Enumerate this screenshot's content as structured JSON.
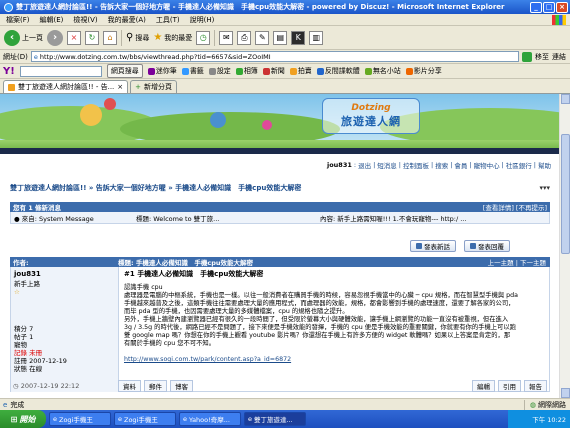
{
  "window": {
    "title": "雙丁旅遊達人網討論區!! - 告訴大家一個好地方喔 - 手機達人必備知識　手機cpu效能大解密 - powered by Discuz! - Microsoft Internet Explorer"
  },
  "menu": [
    "檔案(F)",
    "編輯(E)",
    "檢視(V)",
    "我的最愛(A)",
    "工具(T)",
    "說明(H)"
  ],
  "toolbar": {
    "back_label": "上一頁",
    "search_label": "搜尋",
    "favorites_label": "我的最愛"
  },
  "address": {
    "label": "網址(D)",
    "url": "http://www.dotzing.com.tw/bbs/viewthread.php?tid=6657&sid=ZOoIMI",
    "go_label": "移至",
    "links_label": "連結"
  },
  "yahoo": {
    "logo": "Y!",
    "search_button": "網頁搜尋",
    "items": [
      "迷你筆",
      "書籤",
      "設定",
      "相簿",
      "新聞",
      "拍賣",
      "反間諜軟體",
      "無名小站",
      "影片分享"
    ]
  },
  "tabs": [
    {
      "label": "雙丁旅遊達人網討論區!! - 告..."
    },
    {
      "label": "新增分頁"
    }
  ],
  "banner": {
    "logo_top": "Dotzing",
    "logo_bottom": "旅遊達人網"
  },
  "userbar": {
    "user": "jou831",
    "links": [
      "退出",
      "短消息",
      "控制面板",
      "搜索",
      "會員",
      "寵物中心",
      "社區銀行",
      "幫助"
    ]
  },
  "breadcrumb": "雙丁旅遊達人網討論區!! » 告訴大家一個好地方喔 » 手機達人必備知識　手機cpu效能大解密",
  "pm": {
    "header": "您有 1 條新消息",
    "header_right": "[查看詳情] [不再提示]",
    "from": "來自: System Message",
    "subject": "標題: Welcome to 雙丁旅...",
    "content": "內容: 新手上路需知喔!!! 1.不會玩寵物--- http:/ ..."
  },
  "actions": {
    "new_thread": "發表新話",
    "reply": "發表回覆"
  },
  "post": {
    "header_author": "作者:",
    "header_title": "標題: 手機達人必備知識　手機cpu效能大解密",
    "header_nav": "上一主題 | 下一主題",
    "author_name": "jou831",
    "author_rank": "新手上路",
    "author_star": "☆",
    "stats": [
      "積分 7",
      "帖子 1",
      "寵物",
      "記錄 未冊",
      "註冊 2007-12-19",
      "狀態 在線"
    ],
    "number": "#1",
    "title": "手機達人必備知識　手機cpu效能大解密",
    "body_lines": [
      "認識手機 cpu",
      "處理器是電腦的中樞系統，手機也是一樣。以往一般消費者在購買手機的時候，容易忽視手機當中的心臟 ─ cpu 規格，而在智慧型手機與 pda",
      "手機越來越普及之後，這類手機往往需要處理大量的應用程式，而處理器的效能，規格，都會影響到手機的處理速度，還要了解各家的公司，",
      "而毕 pda 型的手機，也因需要處理大量的多媒體檔案，cpu 的規格也隨之提升。",
      "另外，手機上牆壁內建瀏覽器已經有很久的一段時間了，但受限於螢幕大小與硬體效能，讓手機上網瀏覽的功能一直沒有被重視，但在進入",
      "3g / 3.5g 的時代後，網路已經不是問題了，接下來便是手機效能的發揮，手機的 cpu 便是手機效能的重要關鍵，你就要有你的手機上可以跑",
      "雙 google map 嗎？你想在你的手機上觀看 youtube 影片嗎？你還想在手機上有許多方便的 widget 軟體嗎？如果以上答案是肯定的，那",
      "有關於手機的 cpu 您不可不知。"
    ],
    "link": "http://www.sogi.com.tw/park/content.asp?a_id=6872",
    "timestamp": "2007-12-19 22:12",
    "footer_left": [
      "資料",
      "郵件",
      "博客"
    ],
    "footer_right": [
      "編輯",
      "引用",
      "報告"
    ]
  },
  "status": {
    "left": "完成",
    "zone": "網際網路"
  },
  "taskbar": {
    "start": "開始",
    "items": [
      "Zogi手機王",
      "Zogi手機王",
      "Yahoo!奇摩...",
      "雙丁旅遊達..."
    ],
    "clock": "下午 10:22"
  }
}
